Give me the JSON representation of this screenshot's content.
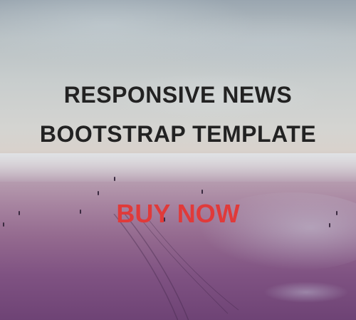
{
  "banner": {
    "headline_line1": "RESPONSIVE NEWS",
    "headline_line2": "BOOTSTRAP TEMPLATE",
    "cta_label": "BUY NOW"
  },
  "colors": {
    "headline": "#222222",
    "cta": "#e03a3a",
    "overlay_tint": "#6e4375"
  }
}
